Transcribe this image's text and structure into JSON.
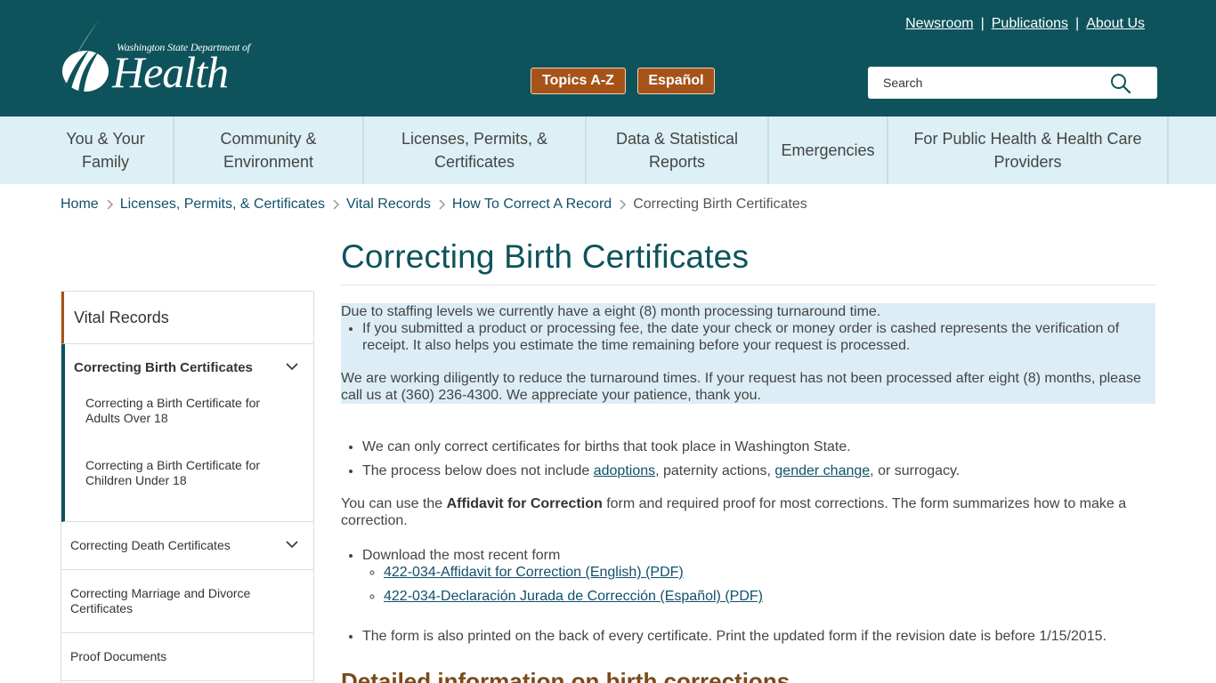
{
  "header": {
    "logo": {
      "small_text": "Washington State Department of",
      "big_text": "Health"
    },
    "utility_links": [
      "Newsroom",
      "Publications",
      "About Us"
    ],
    "utility_separator": "|",
    "topics_button": "Topics A-Z",
    "espanol_button": "Español",
    "search": {
      "placeholder": "Search"
    }
  },
  "nav": {
    "items": [
      "You & Your Family",
      "Community & Environment",
      "Licenses, Permits, & Certificates",
      "Data & Statistical Reports",
      "Emergencies",
      "For Public Health & Health Care Providers"
    ]
  },
  "breadcrumb": {
    "items": [
      "Home",
      "Licenses, Permits, & Certificates",
      "Vital Records",
      "How To Correct A Record"
    ],
    "current": "Correcting Birth Certificates"
  },
  "sidebar": {
    "heading": "Vital Records",
    "open_section": "Correcting Birth Certificates",
    "open_subitems": [
      "Correcting a Birth Certificate for Adults Over 18",
      "Correcting a Birth Certificate for Children Under 18"
    ],
    "items": [
      "Correcting Death Certificates",
      "Correcting Marriage and Divorce Certificates",
      "Proof Documents"
    ]
  },
  "content": {
    "title": "Correcting Birth Certificates",
    "notice": {
      "p1": "Due to staffing levels we currently have a eight (8) month processing turnaround time.",
      "bullet": "If you submitted a product or processing fee, the date your check or money order is cashed represents the verification of receipt. It also helps you estimate the time remaining before your request is processed.",
      "p2": "We are working diligently to reduce the turnaround times. If your request has not been processed after eight (8) months, please call us at (360) 236-4300. We appreciate your patience, thank you."
    },
    "bullet1": "We can only correct certificates for births that took place in Washington State.",
    "bullet2": {
      "before": "The process below does not include ",
      "link1": "adoptions",
      "mid1": ", paternity actions, ",
      "link2": "gender change",
      "after": ", or surrogacy."
    },
    "affidavit_para": {
      "before": "You can use the ",
      "bold": "Affidavit for Correction",
      "after": " form and required proof for most corrections. The form summarizes how to make a correction."
    },
    "download_label": "Download the most recent form",
    "download_links": [
      "422-034-Affidavit for Correction (English) (PDF)",
      "422-034-Declaración Jurada de Corrección (Español) (PDF)"
    ],
    "printed_note": "The form is also printed on the back of every certificate. Print the updated form if the revision date is before 1/15/2015.",
    "detail_heading": "Detailed information on birth corrections"
  },
  "colors": {
    "header_bg": "#0e535c",
    "nav_bg": "#dcf0f5",
    "accent_orange": "#a6531a",
    "notice_bg": "#dcedf5",
    "link": "#10506a"
  }
}
